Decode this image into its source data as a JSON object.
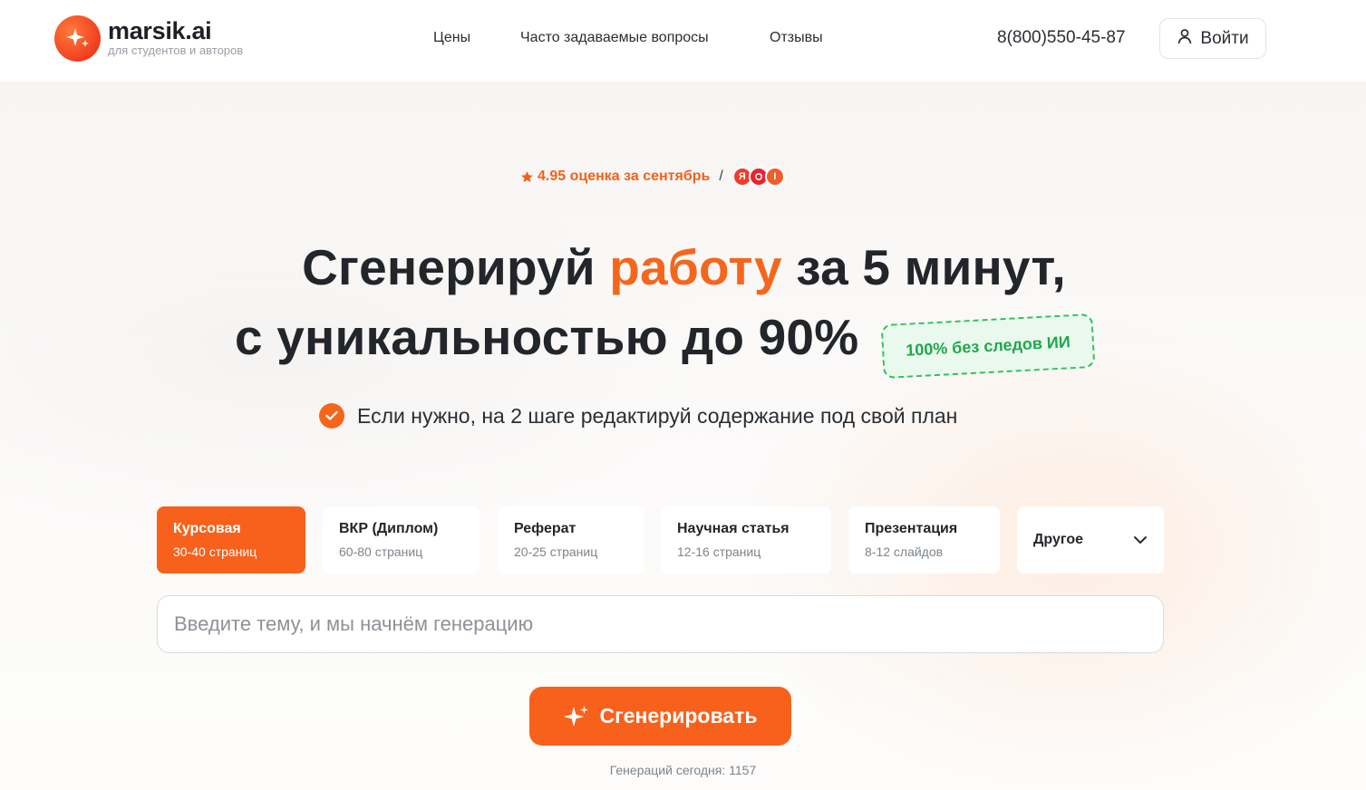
{
  "brand": {
    "name": "marsik.ai",
    "tagline": "для студентов и авторов",
    "accent_color": "#f5661d"
  },
  "nav": {
    "items": [
      {
        "label": "Цены"
      },
      {
        "label": "Часто задаваемые вопросы"
      },
      {
        "label": "Отзывы"
      }
    ],
    "phone": "8(800)550-45-87",
    "login_label": "Войти"
  },
  "rating": {
    "text": "4.95 оценка за сентябрь",
    "separator": "/",
    "sources": [
      "yandex-badge-icon",
      "otzovik-badge-icon",
      "irecommend-badge-icon"
    ]
  },
  "hero": {
    "line1_pre": "Сгенерируй",
    "line1_accent": "работу",
    "line1_post": "за 5 минут,",
    "line2": "с уникальностью до 90%",
    "stamp": "100% без следов ИИ",
    "note": "Если нужно, на 2 шаге редактируй содержание под свой план"
  },
  "work_types": [
    {
      "title": "Курсовая",
      "subtitle": "30-40 страниц",
      "active": true
    },
    {
      "title": "ВКР (Диплом)",
      "subtitle": "60-80 страниц",
      "active": false
    },
    {
      "title": "Реферат",
      "subtitle": "20-25 страниц",
      "active": false
    },
    {
      "title": "Научная статья",
      "subtitle": "12-16 страниц",
      "active": false
    },
    {
      "title": "Презентация",
      "subtitle": "8-12 слайдов",
      "active": false
    }
  ],
  "other_dropdown": {
    "label": "Другое"
  },
  "topic_input": {
    "value": "",
    "placeholder": "Введите тему, и мы начнём генерацию"
  },
  "generate_button": {
    "label": "Сгенерировать"
  },
  "counter": "Генераций сегодня: 1157"
}
